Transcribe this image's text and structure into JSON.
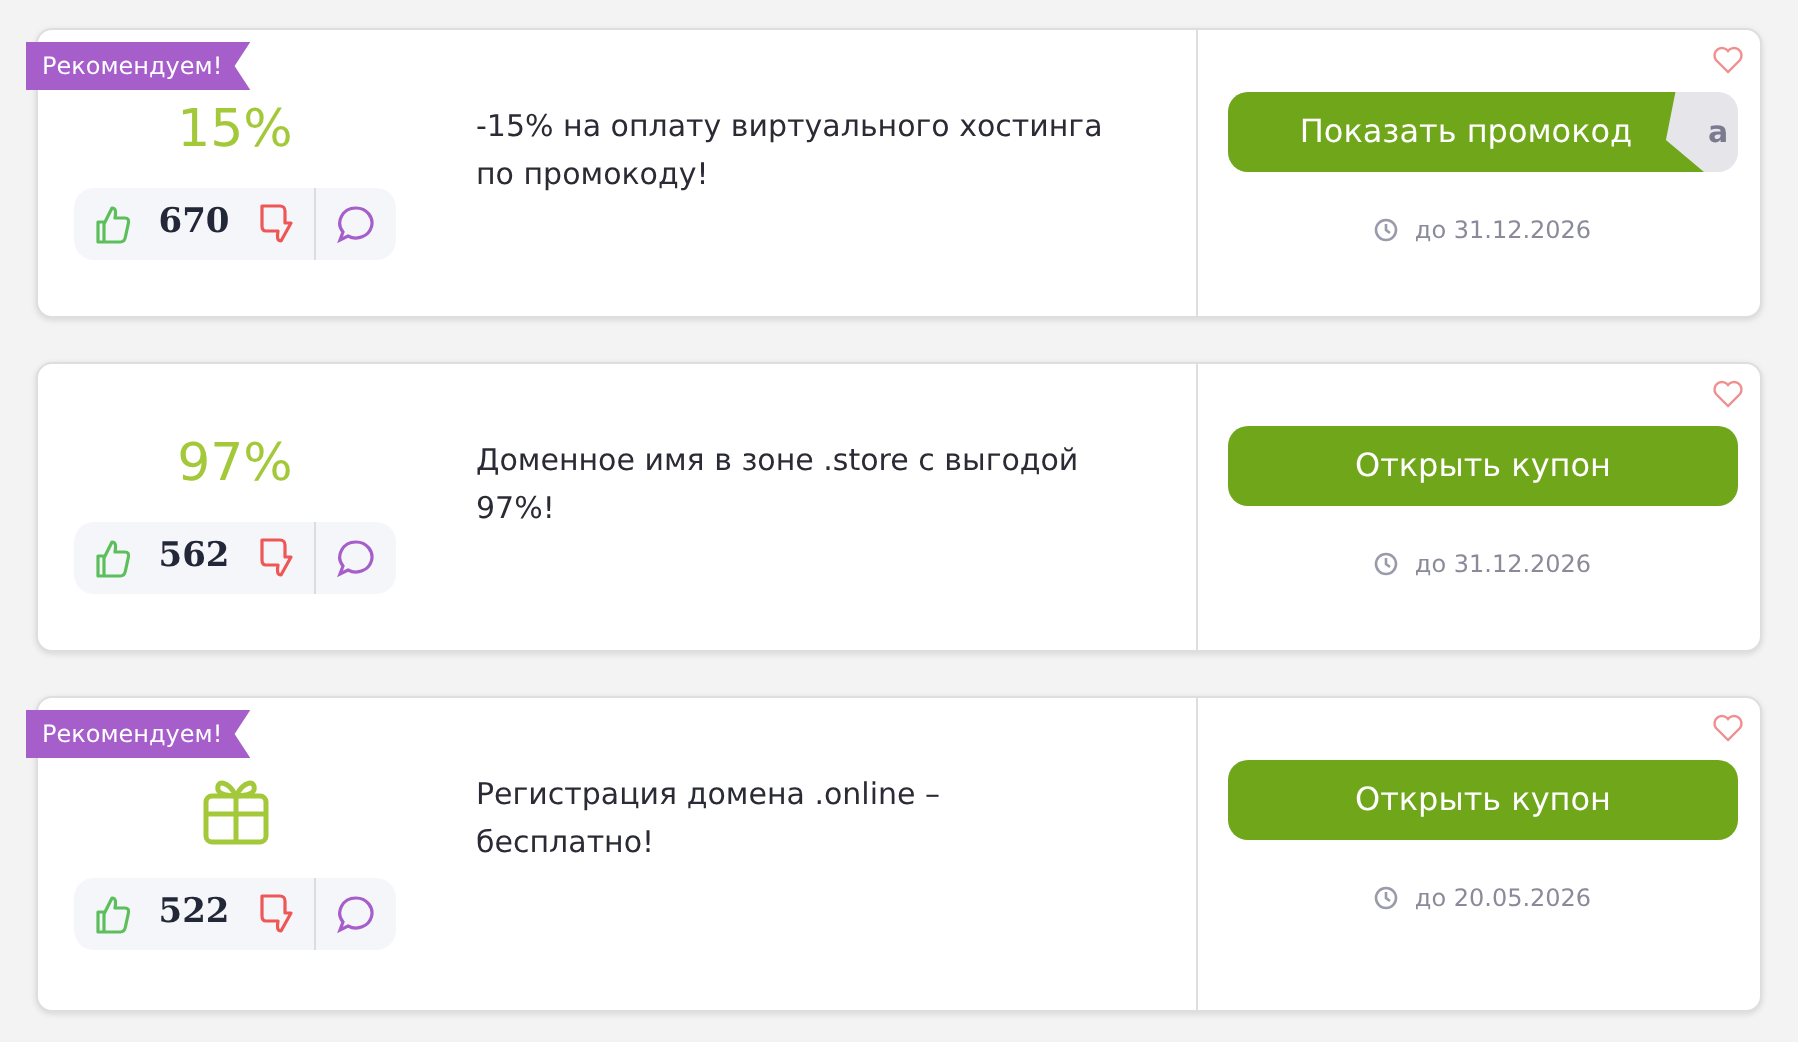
{
  "offers": [
    {
      "recommended": true,
      "recommended_label": "Рекомендуем!",
      "badge": {
        "kind": "percent",
        "text": "15%"
      },
      "votes": "670",
      "description": "-15% на оплату виртуального хостинга по промокоду!",
      "action": {
        "kind": "promo",
        "label": "Показать промокод",
        "peek": "a"
      },
      "expires": "до 31.12.2026"
    },
    {
      "recommended": false,
      "badge": {
        "kind": "percent",
        "text": "97%"
      },
      "votes": "562",
      "description": "Доменное имя в зоне .store с выгодой 97%!",
      "action": {
        "kind": "coupon",
        "label": "Открыть купон"
      },
      "expires": "до 31.12.2026"
    },
    {
      "recommended": true,
      "recommended_label": "Рекомендуем!",
      "badge": {
        "kind": "gift"
      },
      "votes": "522",
      "description": "Регистрация домена .online – бесплатно!",
      "action": {
        "kind": "coupon",
        "label": "Открыть купон"
      },
      "expires": "до 20.05.2026"
    }
  ]
}
